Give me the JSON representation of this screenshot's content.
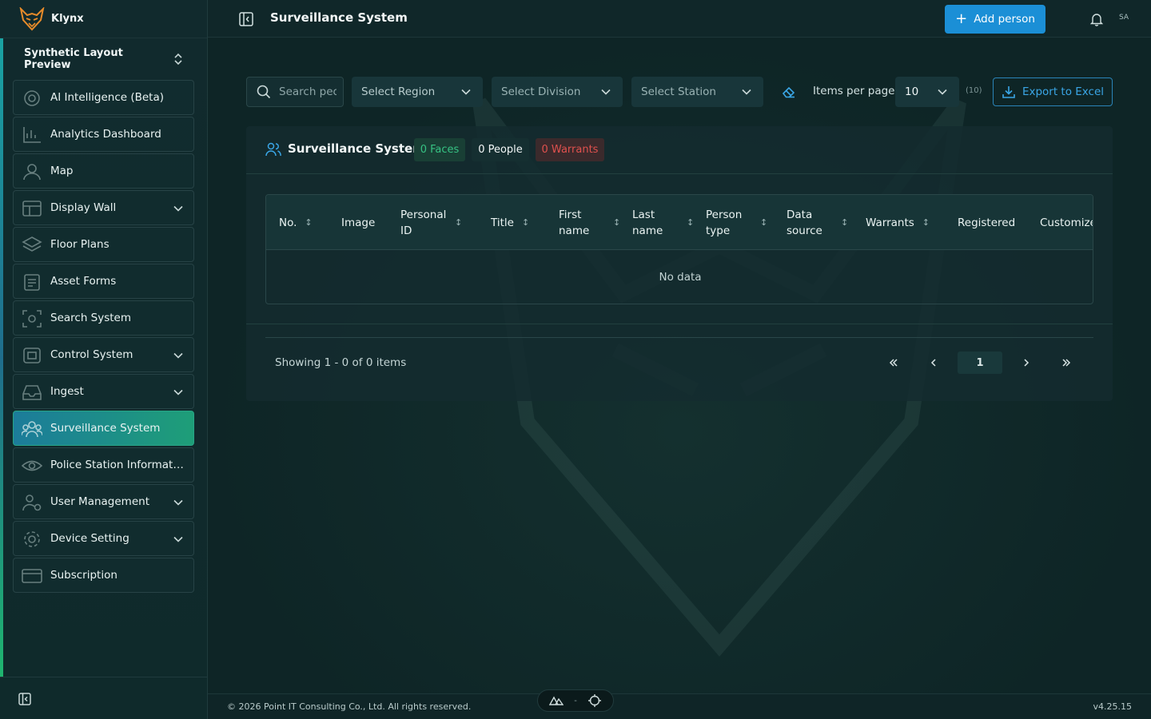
{
  "brand": {
    "name": "Klynx"
  },
  "workspace": {
    "name": "Synthetic Layout Preview",
    "icon": "chevron-up-down-icon"
  },
  "sidebar": {
    "items": [
      {
        "label": "AI Intelligence (Beta)",
        "icon": "ai-target-icon",
        "expandable": false,
        "active": false
      },
      {
        "label": "Analytics Dashboard",
        "icon": "chart-icon",
        "expandable": false,
        "active": false
      },
      {
        "label": "Map",
        "icon": "user-pin-icon",
        "expandable": false,
        "active": false
      },
      {
        "label": "Display Wall",
        "icon": "display-wall-icon",
        "expandable": true,
        "active": false
      },
      {
        "label": "Floor Plans",
        "icon": "layers-icon",
        "expandable": false,
        "active": false
      },
      {
        "label": "Asset Forms",
        "icon": "clipboard-icon",
        "expandable": false,
        "active": false
      },
      {
        "label": "Search System",
        "icon": "scan-face-icon",
        "expandable": false,
        "active": false
      },
      {
        "label": "Control System",
        "icon": "control-icon",
        "expandable": true,
        "active": false
      },
      {
        "label": "Ingest",
        "icon": "inbox-icon",
        "expandable": true,
        "active": false
      },
      {
        "label": "Surveillance System",
        "icon": "group-icon",
        "expandable": false,
        "active": true
      },
      {
        "label": "Police Station Informati...",
        "icon": "eye-icon",
        "expandable": false,
        "active": false
      },
      {
        "label": "User Management",
        "icon": "users-gear-icon",
        "expandable": true,
        "active": false
      },
      {
        "label": "Device Setting",
        "icon": "gear-icon",
        "expandable": true,
        "active": false
      },
      {
        "label": "Subscription",
        "icon": "card-icon",
        "expandable": false,
        "active": false
      }
    ]
  },
  "header": {
    "title": "Surveillance System",
    "add_person_label": "Add person",
    "avatar_initials": "SA"
  },
  "toolbar": {
    "search_placeholder": "Search people",
    "region_placeholder": "Select Region",
    "division_placeholder": "Select Division",
    "station_placeholder": "Select Station",
    "items_per_page_label": "Items per page",
    "items_per_page_value": "10",
    "items_per_page_count": "(10)",
    "export_label": "Export to Excel"
  },
  "card": {
    "title": "Surveillance System",
    "badges": {
      "faces": "0 Faces",
      "people": "0 People",
      "warrants": "0 Warrants"
    },
    "colors": {
      "faces": "#36c283",
      "warrants": "#e0514e"
    }
  },
  "table": {
    "columns": [
      {
        "label": "No.",
        "sortable": true
      },
      {
        "label": "Image",
        "sortable": false
      },
      {
        "label": "Personal ID",
        "sortable": true
      },
      {
        "label": "Title",
        "sortable": true
      },
      {
        "label": "First name",
        "sortable": true
      },
      {
        "label": "Last name",
        "sortable": true
      },
      {
        "label": "Person type",
        "sortable": true
      },
      {
        "label": "Data source",
        "sortable": true
      },
      {
        "label": "Warrants",
        "sortable": true
      },
      {
        "label": "Registered",
        "sortable": false
      },
      {
        "label": "Customize",
        "sortable": false
      }
    ],
    "empty_text": "No data"
  },
  "pagination": {
    "summary": "Showing 1 - 0 of 0 items",
    "current_page": "1"
  },
  "footer": {
    "copyright": "© 2026 Point IT Consulting Co., Ltd. All rights reserved.",
    "version": "v4.25.15",
    "devtools_separator": "-"
  },
  "colors": {
    "accent_blue": "#1b8fd6",
    "active_gradient_start": "#1c7c9a",
    "active_gradient_end": "#1e9e78"
  }
}
